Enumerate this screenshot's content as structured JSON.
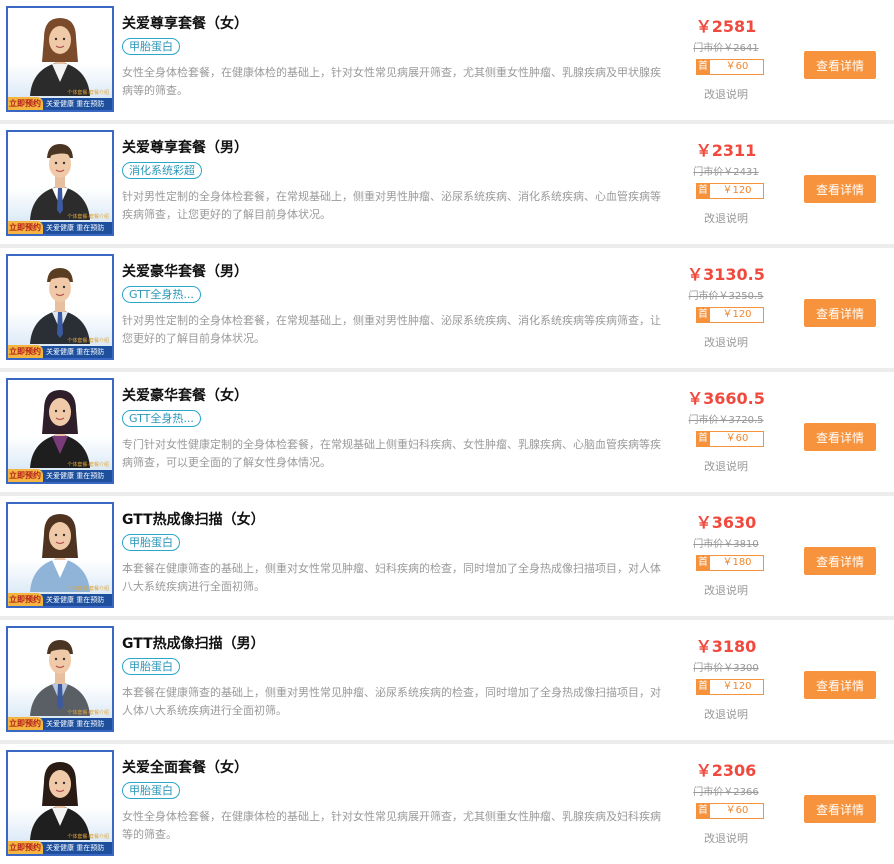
{
  "thumb": {
    "badge": "立即预约",
    "slogan": "关爱健康  重在预防",
    "tiny": "个体套餐·套餐介绍"
  },
  "packages": [
    {
      "title": "关爱尊享套餐（女）",
      "tag": "甲胎蛋白",
      "desc": "女性全身体检套餐，在健康体检的基础上，针对女性常见病展开筛查，尤其侧重女性肿瘤、乳腺疾病及甲状腺疾病等的筛查。",
      "price": "￥2581",
      "market": "门市价￥2641",
      "coupon_head": "首",
      "coupon": "￥60",
      "refund": "改退说明",
      "button": "查看详情",
      "gender": "female",
      "colors": {
        "hair": "#7a4a2a",
        "suit": "#2b2b2b",
        "shirt": "#f2f2f2"
      }
    },
    {
      "title": "关爱尊享套餐（男）",
      "tag": "消化系统彩超",
      "desc": "针对男性定制的全身体检套餐，在常规基础上，侧重对男性肿瘤、泌尿系统疾病、消化系统疾病、心血管疾病等疾病筛查，让您更好的了解目前身体状况。",
      "price": "￥2311",
      "market": "门市价￥2431",
      "coupon_head": "首",
      "coupon": "￥120",
      "refund": "改退说明",
      "button": "查看详情",
      "gender": "male",
      "colors": {
        "hair": "#4a3424",
        "suit": "#2c2c2c",
        "shirt": "#ffffff"
      }
    },
    {
      "title": "关爱豪华套餐（男）",
      "tag": "GTT全身热...",
      "desc": "针对男性定制的全身体检套餐，在常规基础上，侧重对男性肿瘤、泌尿系统疾病、消化系统疾病等疾病筛查，让您更好的了解目前身体状况。",
      "price": "￥3130.5",
      "market": "门市价￥3250.5",
      "coupon_head": "首",
      "coupon": "￥120",
      "refund": "改退说明",
      "button": "查看详情",
      "gender": "male",
      "colors": {
        "hair": "#5a3e24",
        "suit": "#2a2f36",
        "shirt": "#dfe8f1"
      }
    },
    {
      "title": "关爱豪华套餐（女）",
      "tag": "GTT全身热...",
      "desc": "专门针对女性健康定制的全身体检套餐，在常规基础上侧重妇科疾病、女性肿瘤、乳腺疾病、心脑血管疾病等疾病筛查，可以更全面的了解女性身体情况。",
      "price": "￥3660.5",
      "market": "门市价￥3720.5",
      "coupon_head": "首",
      "coupon": "￥60",
      "refund": "改退说明",
      "button": "查看详情",
      "gender": "female",
      "colors": {
        "hair": "#2e1e2a",
        "suit": "#1e1e1e",
        "shirt": "#7a3b7a"
      }
    },
    {
      "title": "GTT热成像扫描（女）",
      "tag": "甲胎蛋白",
      "desc": "本套餐在健康筛查的基础上，侧重对女性常见肿瘤、妇科疾病的检查，同时增加了全身热成像扫描项目，对人体八大系统疾病进行全面初筛。",
      "price": "￥3630",
      "market": "门市价￥3810",
      "coupon_head": "首",
      "coupon": "￥180",
      "refund": "改退说明",
      "button": "查看详情",
      "gender": "female",
      "colors": {
        "hair": "#4e3420",
        "suit": "#8fb4d8",
        "shirt": "#ffffff"
      }
    },
    {
      "title": "GTT热成像扫描（男）",
      "tag": "甲胎蛋白",
      "desc": "本套餐在健康筛查的基础上，侧重对男性常见肿瘤、泌尿系统疾病的检查，同时增加了全身热成像扫描项目，对人体八大系统疾病进行全面初筛。",
      "price": "￥3180",
      "market": "门市价￥3300",
      "coupon_head": "首",
      "coupon": "￥120",
      "refund": "改退说明",
      "button": "查看详情",
      "gender": "male",
      "colors": {
        "hair": "#4a3424",
        "suit": "#5a5f66",
        "shirt": "#b8c8e0"
      }
    },
    {
      "title": "关爱全面套餐（女）",
      "tag": "甲胎蛋白",
      "desc": "女性全身体检套餐，在健康体检的基础上，针对女性常见病展开筛查，尤其侧重女性肿瘤、乳腺疾病及妇科疾病等的筛查。",
      "price": "￥2306",
      "market": "门市价￥2366",
      "coupon_head": "首",
      "coupon": "￥60",
      "refund": "改退说明",
      "button": "查看详情",
      "gender": "female",
      "colors": {
        "hair": "#2a1c14",
        "suit": "#1f1f1f",
        "shirt": "#f4f4f4"
      }
    }
  ]
}
